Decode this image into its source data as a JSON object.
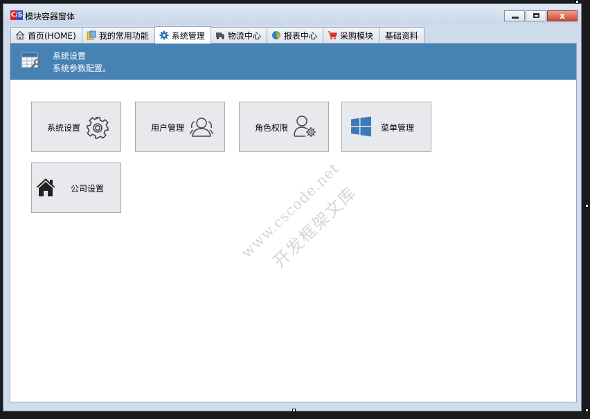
{
  "window": {
    "app_icon_text": "C/S",
    "title": "模块容器窗体",
    "controls": {
      "close": "x"
    }
  },
  "tabs": [
    {
      "label": "首页(HOME)",
      "icon": "home-icon",
      "active": false
    },
    {
      "label": "我的常用功能",
      "icon": "favorites-icon",
      "active": false
    },
    {
      "label": "系统管理",
      "icon": "gear-icon",
      "active": true
    },
    {
      "label": "物流中心",
      "icon": "truck-icon",
      "active": false
    },
    {
      "label": "报表中心",
      "icon": "pie-chart-icon",
      "active": false
    },
    {
      "label": "采购模块",
      "icon": "cart-icon",
      "active": false
    },
    {
      "label": "基础资料",
      "icon": null,
      "active": false
    }
  ],
  "banner": {
    "icon": "settings-grid-icon",
    "title": "系统设置",
    "subtitle": "系统参数配置。",
    "background": "#4682b4"
  },
  "tiles": [
    {
      "label": "系统设置",
      "icon": "gear-icon"
    },
    {
      "label": "用户管理",
      "icon": "users-icon"
    },
    {
      "label": "角色权限",
      "icon": "user-gear-icon"
    },
    {
      "label": "菜单管理",
      "icon": "windows-icon"
    },
    {
      "label": "公司设置",
      "icon": "home-icon"
    }
  ],
  "watermark": {
    "line1": "www.cscode.net",
    "line2": "开发框架文库"
  }
}
